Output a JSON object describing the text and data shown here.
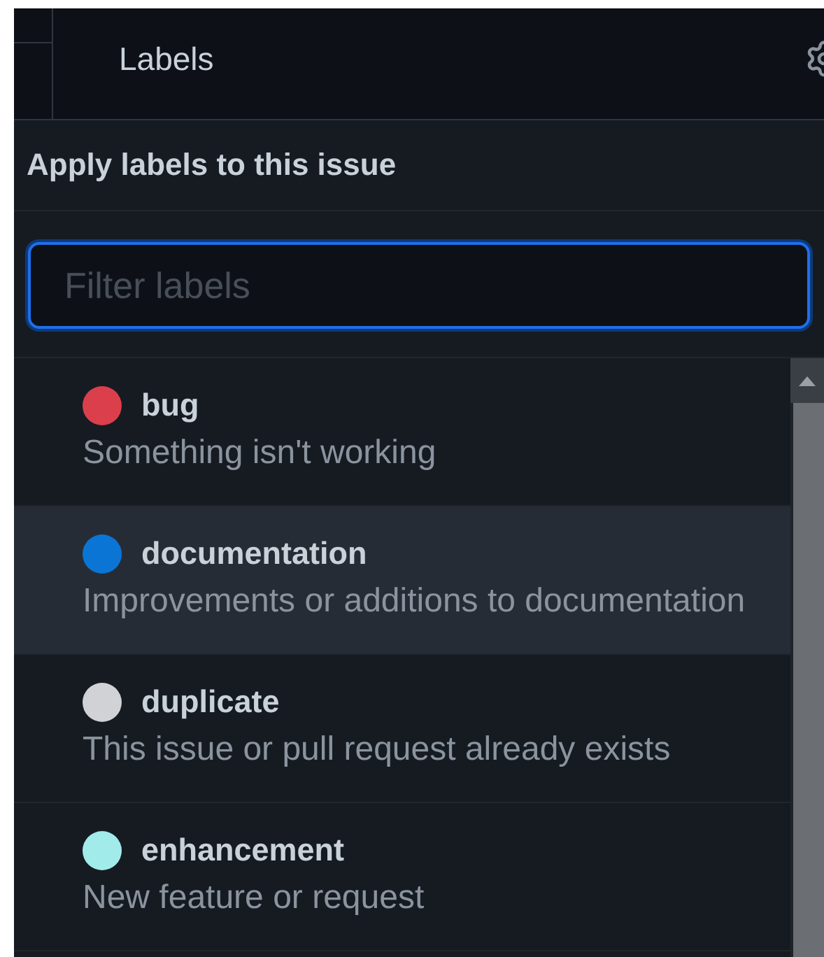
{
  "header": {
    "title": "Labels"
  },
  "popup": {
    "title": "Apply labels to this issue",
    "filter": {
      "placeholder": "Filter labels"
    },
    "labels": [
      {
        "name": "bug",
        "description": "Something isn't working",
        "color": "#db3f4c",
        "selected": false
      },
      {
        "name": "documentation",
        "description": "Improvements or additions to documentation",
        "color": "#0a75d5",
        "selected": true
      },
      {
        "name": "duplicate",
        "description": "This issue or pull request already exists",
        "color": "#d0d2d5",
        "selected": false
      },
      {
        "name": "enhancement",
        "description": "New feature or request",
        "color": "#a2ebeb",
        "selected": false
      }
    ]
  }
}
